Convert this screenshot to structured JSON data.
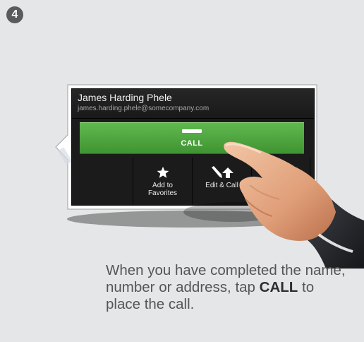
{
  "step": {
    "number": "4"
  },
  "contact": {
    "name": "James Harding Phele",
    "email": "james.harding.phele@somecompany.com"
  },
  "call_button": {
    "label": "CALL"
  },
  "actions": [
    {
      "icon": "star-icon",
      "label": "Add to Favorites"
    },
    {
      "icon": "pencil-arrow-icon",
      "label": "Edit & Call"
    }
  ],
  "instruction": {
    "before": "When you have completed the name, number or address, tap ",
    "emphasis": "CALL",
    "after": " to place the call."
  },
  "colors": {
    "background": "#e5e6e7",
    "call_green": "#4fa83f",
    "panel_dark": "#1b1b1b",
    "badge": "#5a5b5c"
  }
}
